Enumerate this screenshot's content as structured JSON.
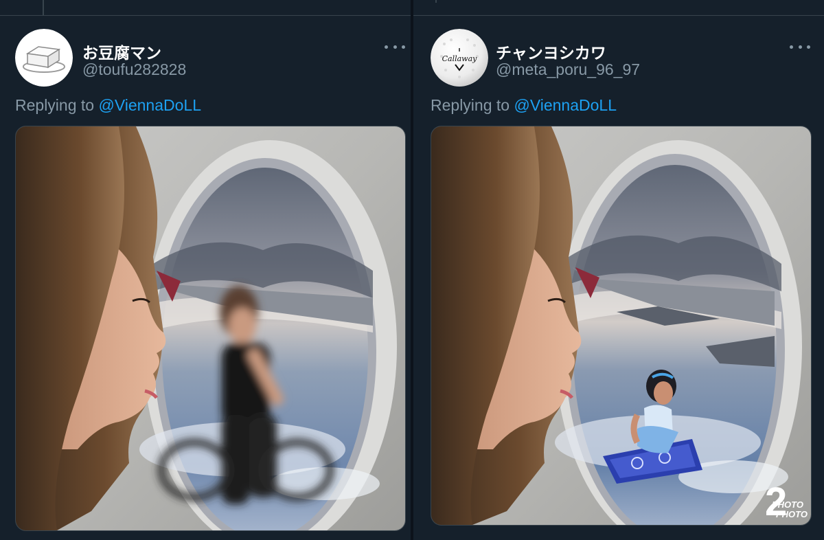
{
  "tweets": [
    {
      "display_name": "お豆腐マン",
      "handle": "@toufu282828",
      "replying_prefix": "Replying to ",
      "replying_to": "@ViennaDoLL",
      "avatar_icon": "tofu-icon",
      "media_description": "woman-at-airplane-window-with-cyclist-photoshop"
    },
    {
      "display_name": "チャンヨシカワ",
      "handle": "@meta_poru_96_97",
      "replying_prefix": "Replying to ",
      "replying_to": "@ViennaDoLL",
      "avatar_icon": "golf-ball-icon",
      "avatar_text": "Callaway",
      "media_description": "woman-at-airplane-window-with-magic-carpet-photoshop",
      "watermark_big": "2",
      "watermark_line1": "PHOTO",
      "watermark_line2": "PHOTO"
    }
  ],
  "colors": {
    "background": "#15202b",
    "text_primary": "#ffffff",
    "text_secondary": "#8899a6",
    "link": "#1da1f2",
    "border": "#38444d"
  }
}
